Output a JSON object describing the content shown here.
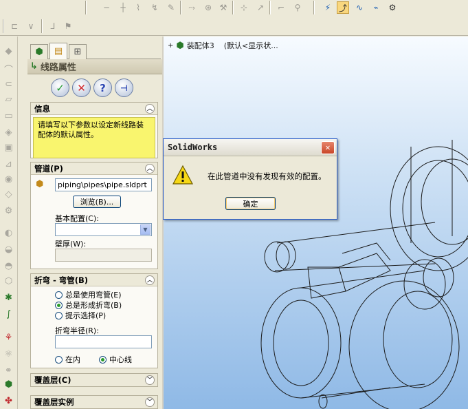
{
  "property_manager": {
    "title": "线路属性",
    "tabs": [
      "feature-manager",
      "property-manager",
      "configuration-manager"
    ],
    "actions": {
      "ok": "✓",
      "cancel": "✕",
      "help": "?",
      "pin": "⊣"
    },
    "info": {
      "header": "信息",
      "text": "请填写以下参数以设定新线路装配体的默认属性。"
    },
    "pipe": {
      "header": "管道(P)",
      "file_value": "piping\\pipes\\pipe.sldprt",
      "browse_label": "浏览(B)...",
      "base_config_label": "基本配置(C):",
      "base_config_value": "",
      "wall_label": "壁厚(W):",
      "wall_value": ""
    },
    "bends": {
      "header": "折弯 - 弯管(B)",
      "options": [
        {
          "label": "总是使用弯管(E)",
          "selected": false
        },
        {
          "label": "总是形成折弯(B)",
          "selected": true
        },
        {
          "label": "提示选择(P)",
          "selected": false
        }
      ],
      "radius_label": "折弯半径(R):",
      "radius_value": "",
      "inner_label": "在内",
      "inner_selected": false,
      "center_label": "中心线",
      "center_selected": true
    },
    "covering": {
      "header": "覆盖层(C)"
    },
    "covering_instances": {
      "header": "覆盖层实例"
    }
  },
  "graphics": {
    "tree_label": "装配体3",
    "tree_config": "(默认<显示状..."
  },
  "dialog": {
    "title": "SolidWorks",
    "message": "在此管道中没有发现有效的配置。",
    "ok_label": "确定",
    "close_glyph": "✕"
  },
  "colors": {
    "accent_blue": "#2a5cc7",
    "info_yellow": "#f9f56e",
    "ok_green": "#1e9a2c",
    "cancel_red": "#d1272c"
  }
}
